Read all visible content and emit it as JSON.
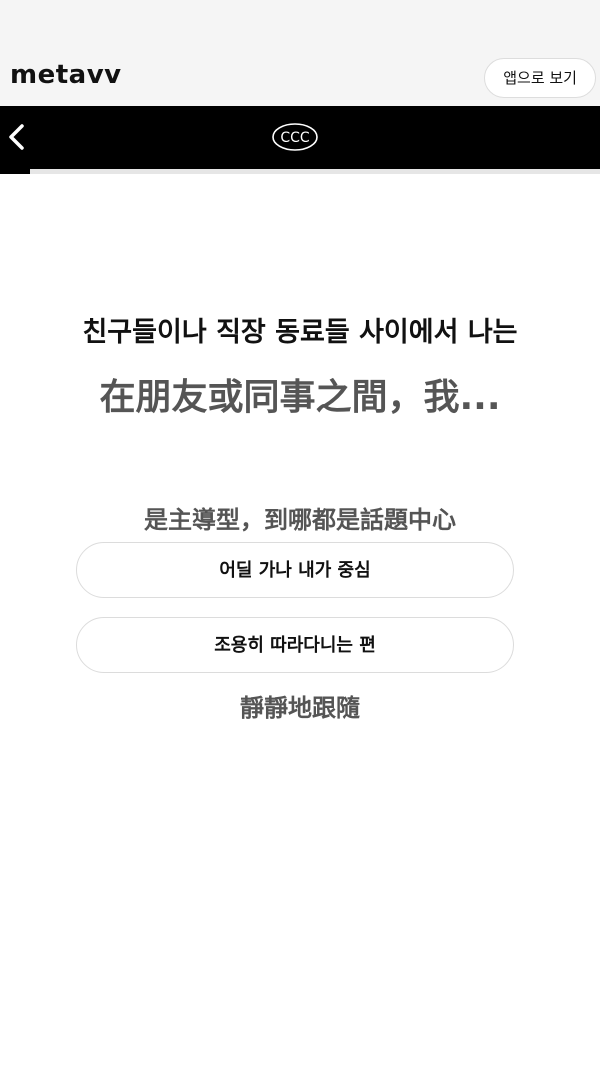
{
  "header": {
    "brand": "metavv",
    "open_in_app": "앱으로 보기"
  },
  "navbar": {
    "back_icon": "chevron-left-icon",
    "logo_text": "CCC"
  },
  "progress": {
    "fraction": 0.05
  },
  "question": {
    "text_ko": "친구들이나 직장 동료들 사이에서 나는",
    "text_zh": "在朋友或同事之間，我..."
  },
  "options": [
    {
      "annotation_zh": "是主導型，到哪都是話題中心",
      "label_ko": "어딜 가나 내가 중심"
    },
    {
      "label_ko": "조용히 따라다니는 편",
      "annotation_zh": "靜靜地跟隨"
    }
  ],
  "colors": {
    "navbar": "#000000",
    "background": "#ffffff",
    "topbar": "#f5f5f5"
  }
}
